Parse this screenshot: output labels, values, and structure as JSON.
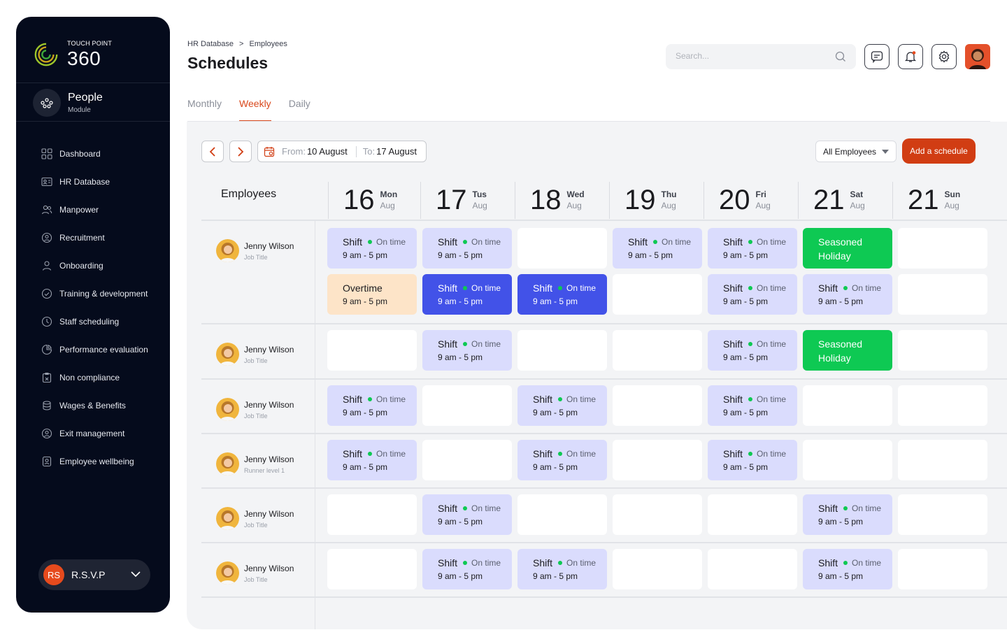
{
  "brand": {
    "small": "TOUCH POINT",
    "big": "360"
  },
  "module": {
    "title": "People",
    "subtitle": "Module"
  },
  "nav": [
    {
      "label": "Dashboard",
      "icon": "dashboard-icon"
    },
    {
      "label": "HR Database",
      "icon": "id-card-icon"
    },
    {
      "label": "Manpower",
      "icon": "users-icon"
    },
    {
      "label": "Recruitment",
      "icon": "recruitment-icon"
    },
    {
      "label": "Onboarding",
      "icon": "user-icon"
    },
    {
      "label": "Training & development",
      "icon": "training-icon"
    },
    {
      "label": "Staff scheduling",
      "icon": "clock-icon"
    },
    {
      "label": "Performance evaluation",
      "icon": "chart-icon"
    },
    {
      "label": "Non compliance",
      "icon": "clipboard-icon"
    },
    {
      "label": "Wages & Benefits",
      "icon": "coins-icon"
    },
    {
      "label": "Exit management",
      "icon": "exit-icon"
    },
    {
      "label": "Employee wellbeing",
      "icon": "wellbeing-icon"
    }
  ],
  "account": {
    "initials": "RS",
    "name": "R.S.V.P"
  },
  "breadcrumb": {
    "first": "HR Database",
    "sep": ">",
    "second": "Employees"
  },
  "page_title": "Schedules",
  "search": {
    "placeholder": "Search..."
  },
  "tabs": [
    "Monthly",
    "Weekly",
    "Daily"
  ],
  "toolbar": {
    "from_label": "From:",
    "from_value": "10 August",
    "to_label": "To:",
    "to_value": "17 August",
    "filter_value": "All Employees",
    "add_label": "Add a schedule"
  },
  "employees_header": "Employees",
  "days": [
    {
      "num": "16",
      "name": "Mon",
      "month": "Aug"
    },
    {
      "num": "17",
      "name": "Tus",
      "month": "Aug"
    },
    {
      "num": "18",
      "name": "Wed",
      "month": "Aug"
    },
    {
      "num": "19",
      "name": "Thu",
      "month": "Aug"
    },
    {
      "num": "20",
      "name": "Fri",
      "month": "Aug"
    },
    {
      "num": "21",
      "name": "Sat",
      "month": "Aug"
    },
    {
      "num": "21",
      "name": "Sun",
      "month": "Aug"
    }
  ],
  "labels": {
    "shift": "Shift",
    "status": "On time",
    "time": "9 am - 5 pm",
    "overtime": "Overtime",
    "holiday1": "Seasoned",
    "holiday2": "Holiday"
  },
  "rows": [
    {
      "name": "Jenny Wilson",
      "title": "Job Title",
      "lines": [
        [
          "shift",
          "shift",
          "empty",
          "shift",
          "shift",
          "holiday",
          "empty"
        ],
        [
          "overtime",
          "active",
          "active",
          "empty",
          "shift",
          "shift",
          "empty"
        ]
      ]
    },
    {
      "name": "Jenny Wilson",
      "title": "Job Title",
      "lines": [
        [
          "empty",
          "shift",
          "empty",
          "empty",
          "shift",
          "holiday",
          "empty"
        ]
      ]
    },
    {
      "name": "Jenny Wilson",
      "title": "Job Title",
      "lines": [
        [
          "shift",
          "empty",
          "shift",
          "empty",
          "shift",
          "empty",
          "empty"
        ]
      ]
    },
    {
      "name": "Jenny Wilson",
      "title": "Runner level 1",
      "lines": [
        [
          "shift",
          "empty",
          "shift",
          "empty",
          "shift",
          "empty",
          "empty"
        ]
      ]
    },
    {
      "name": "Jenny Wilson",
      "title": "Job Title",
      "lines": [
        [
          "empty",
          "shift",
          "empty",
          "empty",
          "empty",
          "shift",
          "empty"
        ]
      ]
    },
    {
      "name": "Jenny Wilson",
      "title": "Job Title",
      "lines": [
        [
          "empty",
          "shift",
          "shift",
          "empty",
          "empty",
          "shift",
          "empty"
        ]
      ]
    }
  ],
  "colors": {
    "accent": "#d13d13",
    "shift": "#dadcfd",
    "active": "#4252e8",
    "holiday": "#0ec953",
    "overtime": "#fde4c8",
    "sidebar": "#050b1c"
  }
}
